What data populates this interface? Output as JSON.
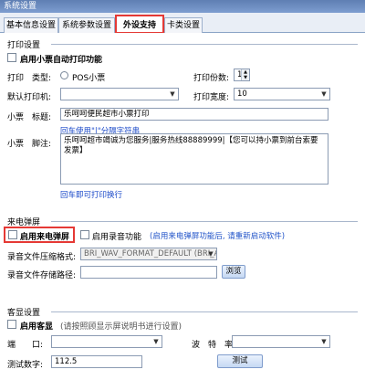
{
  "window": {
    "title": "系统设置"
  },
  "tabs": [
    {
      "label": "基本信息设置"
    },
    {
      "label": "系统参数设置"
    },
    {
      "label": "外设支持"
    },
    {
      "label": "卡类设置"
    }
  ],
  "print": {
    "section_title": "打印设置",
    "auto_print_label": "启用小票自动打印功能",
    "print_type_label": "打印　类型:",
    "print_type_option": "POS小票",
    "copies_label": "打印份数:",
    "copies_value": "1",
    "default_printer_label": "默认打印机:",
    "default_printer_value": "",
    "width_label": "打印宽度:",
    "width_value": "10",
    "ticket_title_label": "小票　标题:",
    "ticket_title_value": "乐呵呵便民超市小票打印",
    "title_hint": "回车使用\"|\"分隔字符串",
    "footer_label": "小票　脚注:",
    "footer_value": "乐呵呵超市竭诚为您服务|服务热线88889999|【您可以持小票到前台索要发票】",
    "footer_hint": "回车即可打印换行"
  },
  "popup": {
    "section_title": "来电弹屏",
    "enable_popup_label": "启用来电弹屏",
    "enable_record_label": "启用录音功能",
    "record_note": "(启用来电弹屏功能后, 请重新启动软件)",
    "compress_label": "录音文件压缩格式:",
    "compress_value": "BRI_WAV_FORMAT_DEFAULT (BRI_AUDI",
    "path_label": "录音文件存储路径:",
    "path_value": "",
    "browse_label": "浏览"
  },
  "display": {
    "section_title": "客显设置",
    "enable_label": "启用客显",
    "enable_note": "(请按照顾显示屏说明书进行设置)",
    "port_label": "端　　口:",
    "port_value": "",
    "baud_label": "波　特　率:",
    "baud_value": "",
    "test_digits_label": "测试数字:",
    "test_digits_value": "112.5",
    "test_button_label": "测试"
  }
}
